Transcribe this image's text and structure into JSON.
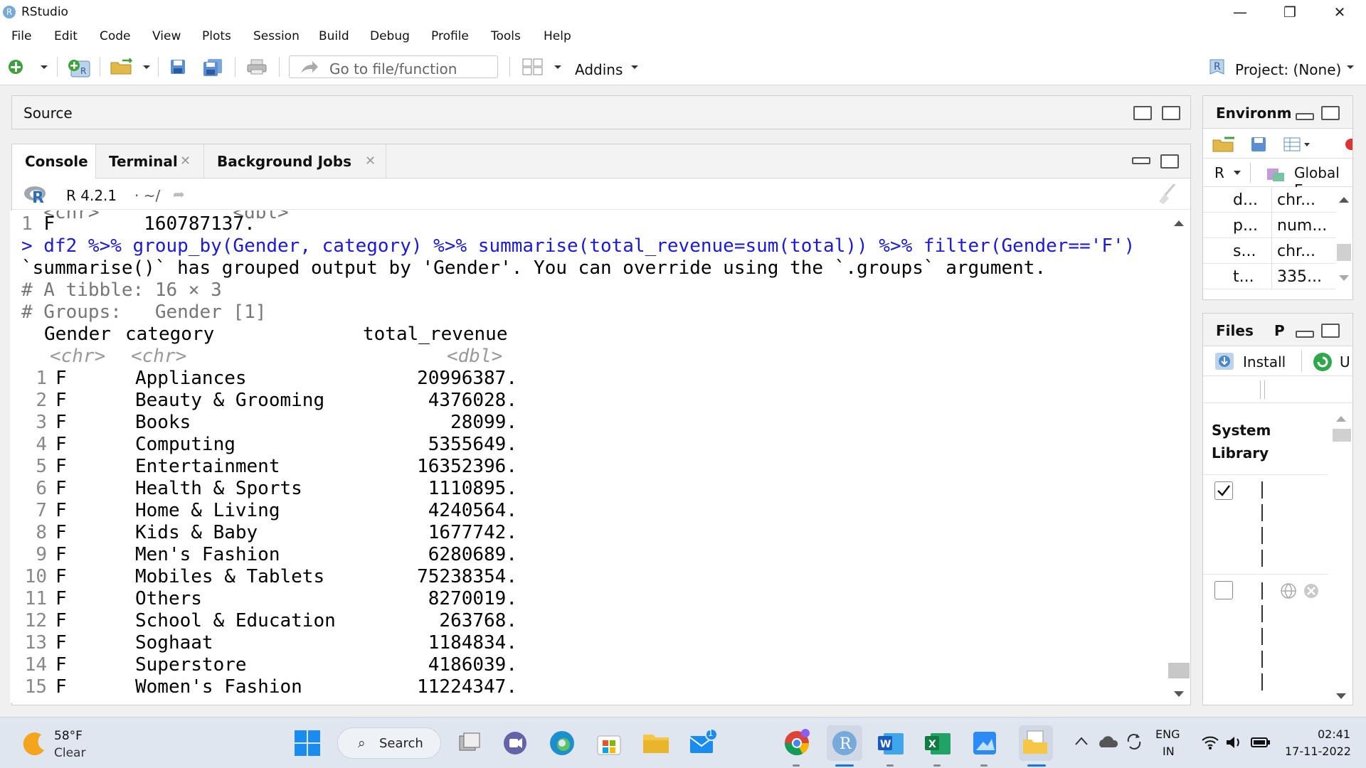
{
  "window": {
    "title": "RStudio",
    "app_icon": "R",
    "minimize": "—",
    "restore": "❐",
    "close": "✕"
  },
  "menu": [
    "File",
    "Edit",
    "Code",
    "View",
    "Plots",
    "Session",
    "Build",
    "Debug",
    "Profile",
    "Tools",
    "Help"
  ],
  "toolbar": {
    "goto_placeholder": "Go to file/function",
    "addins": "Addins",
    "project": "Project: (None)"
  },
  "source_pane": {
    "title": "Source"
  },
  "console_pane": {
    "tabs": [
      {
        "label": "Console"
      },
      {
        "label": "Terminal"
      },
      {
        "label": "Background Jobs"
      }
    ],
    "r_version": "R 4.2.1",
    "path": "· ~/",
    "prev_row": {
      "num": "1",
      "gender": "F",
      "revenue": "160787137."
    },
    "command": "> df2 %>% group_by(Gender, category) %>% summarise(total_revenue=sum(total)) %>% filter(Gender=='F')",
    "message": "`summarise()` has grouped output by 'Gender'. You can override using the `.groups` argument.",
    "tibble_header": "# A tibble: 16 × 3",
    "groups_header": "# Groups:   Gender [1]",
    "columns": [
      "Gender",
      "category",
      "total_revenue"
    ],
    "types": [
      "<chr>",
      "<chr>",
      "<dbl>"
    ],
    "rows": [
      {
        "num": "1",
        "gender": "F",
        "category": "Appliances",
        "revenue": "20996387."
      },
      {
        "num": "2",
        "gender": "F",
        "category": "Beauty & Grooming",
        "revenue": "4376028."
      },
      {
        "num": "3",
        "gender": "F",
        "category": "Books",
        "revenue": "28099."
      },
      {
        "num": "4",
        "gender": "F",
        "category": "Computing",
        "revenue": "5355649."
      },
      {
        "num": "5",
        "gender": "F",
        "category": "Entertainment",
        "revenue": "16352396."
      },
      {
        "num": "6",
        "gender": "F",
        "category": "Health & Sports",
        "revenue": "1110895."
      },
      {
        "num": "7",
        "gender": "F",
        "category": "Home & Living",
        "revenue": "4240564."
      },
      {
        "num": "8",
        "gender": "F",
        "category": "Kids & Baby",
        "revenue": "1677742."
      },
      {
        "num": "9",
        "gender": "F",
        "category": "Men's Fashion",
        "revenue": "6280689."
      },
      {
        "num": "10",
        "gender": "F",
        "category": "Mobiles & Tablets",
        "revenue": "75238354."
      },
      {
        "num": "11",
        "gender": "F",
        "category": "Others",
        "revenue": "8270019."
      },
      {
        "num": "12",
        "gender": "F",
        "category": "School & Education",
        "revenue": "263768."
      },
      {
        "num": "13",
        "gender": "F",
        "category": "Soghaat",
        "revenue": "1184834."
      },
      {
        "num": "14",
        "gender": "F",
        "category": "Superstore",
        "revenue": "4186039."
      },
      {
        "num": "15",
        "gender": "F",
        "category": "Women's Fashion",
        "revenue": "11224347."
      }
    ]
  },
  "env_pane": {
    "title": "Environm",
    "lang": "R",
    "scope": "Global E",
    "rows": [
      {
        "name": "d...",
        "value": "chr..."
      },
      {
        "name": "p...",
        "value": "num..."
      },
      {
        "name": "s...",
        "value": "chr..."
      },
      {
        "name": "t...",
        "value": "335..."
      }
    ]
  },
  "files_pane": {
    "tabs": [
      "Files",
      "P"
    ],
    "install": "Install",
    "update": "U",
    "section": "System Library"
  },
  "taskbar": {
    "weather_temp": "58°F",
    "weather_desc": "Clear",
    "search": "Search",
    "lang_top": "ENG",
    "lang_bottom": "IN",
    "time": "02:41",
    "date": "17-11-2022",
    "mail_badge": "1"
  },
  "colors": {
    "prompt": "#1a1adc",
    "comment": "#777777",
    "r_blue": "#75aadb"
  }
}
